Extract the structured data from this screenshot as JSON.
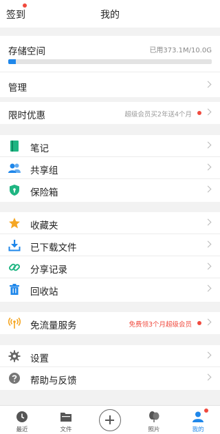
{
  "header": {
    "signin": "签到",
    "title": "我的"
  },
  "storage": {
    "title": "存储空间",
    "used_text": "已用373.1M/10.0G",
    "used_fraction": 0.036,
    "manage": "管理"
  },
  "promo": {
    "label": "限时优惠",
    "hint": "超级会员买2年送4个月"
  },
  "group1": {
    "notes": "笔记",
    "share_group": "共享组",
    "safe_box": "保险箱"
  },
  "group2": {
    "favorites": "收藏夹",
    "downloaded": "已下载文件",
    "share_records": "分享记录",
    "recycle_bin": "回收站"
  },
  "free_traffic": {
    "label": "免流量服务",
    "hint": "免费领3个月超级会员"
  },
  "group3": {
    "settings": "设置",
    "help": "帮助与反馈"
  },
  "tabs": {
    "recent": "最近",
    "files": "文件",
    "photos": "照片",
    "mine": "我的"
  },
  "colors": {
    "accent": "#1f87ea",
    "badge": "#f04a3e",
    "notes_icon": "#1fb582",
    "share_group_icon": "#1f87ea",
    "safe_box_icon": "#1fb582",
    "favorites_icon": "#f5a623",
    "download_icon": "#1f87ea",
    "share_records_icon": "#1fb582",
    "recycle_icon": "#1f87ea",
    "free_traffic_icon": "#f5a623",
    "settings_icon": "#666666"
  }
}
